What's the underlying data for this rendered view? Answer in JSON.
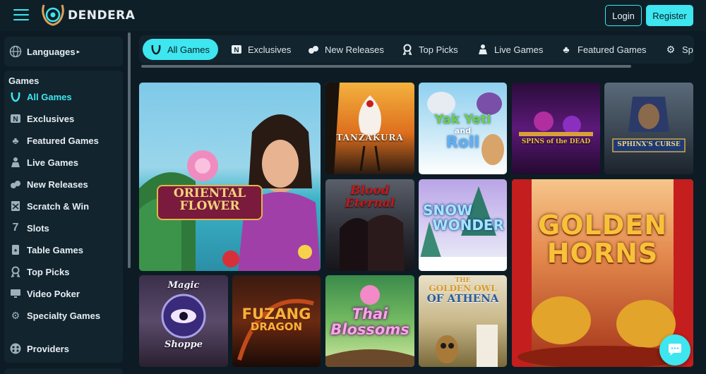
{
  "brand": {
    "name": "DENDERA"
  },
  "header": {
    "login_label": "Login",
    "register_label": "Register"
  },
  "sidebar": {
    "languages_label": "Languages",
    "games_heading": "Games",
    "items": [
      {
        "label": "All Games",
        "icon": "horseshoe-icon",
        "active": true
      },
      {
        "label": "Exclusives",
        "icon": "exclusive-badge-icon"
      },
      {
        "label": "Featured Games",
        "icon": "clover-icon"
      },
      {
        "label": "Live Games",
        "icon": "live-dealer-icon"
      },
      {
        "label": "New Releases",
        "icon": "new-cards-icon"
      },
      {
        "label": "Scratch & Win",
        "icon": "scratch-card-icon"
      },
      {
        "label": "Slots",
        "icon": "seven-icon"
      },
      {
        "label": "Table Games",
        "icon": "playing-card-icon"
      },
      {
        "label": "Top Picks",
        "icon": "medal-icon"
      },
      {
        "label": "Video Poker",
        "icon": "monitor-icon"
      },
      {
        "label": "Specialty Games",
        "icon": "gear-icon"
      }
    ],
    "providers_label": "Providers"
  },
  "tabs": [
    {
      "label": "All Games",
      "icon": "horseshoe-icon",
      "active": true
    },
    {
      "label": "Exclusives",
      "icon": "exclusive-badge-icon"
    },
    {
      "label": "New Releases",
      "icon": "new-cards-icon"
    },
    {
      "label": "Top Picks",
      "icon": "medal-icon"
    },
    {
      "label": "Live Games",
      "icon": "live-dealer-icon"
    },
    {
      "label": "Featured Games",
      "icon": "clover-icon"
    },
    {
      "label": "Sp",
      "icon": "gear-icon"
    }
  ],
  "games": {
    "oriental_flower": {
      "title_line1": "ORIENTAL",
      "title_line2": "FLOWER"
    },
    "tanzakura": {
      "title": "TANZAKURA"
    },
    "yak_yeti": {
      "title_line1": "Yak Yeti",
      "title_line2": "and",
      "title_line3": "Roll"
    },
    "spins_of_the_dead": {
      "title": "SPINS of the DEAD"
    },
    "sphinxs_curse": {
      "title": "SPHINX'S CURSE"
    },
    "blood_eternal": {
      "title_line1": "Blood",
      "title_line2": "Eternal"
    },
    "snow_wonder": {
      "title_line1": "SNOW",
      "title_line2": "WONDER"
    },
    "golden_horns": {
      "title_line1": "GOLDEN",
      "title_line2": "HORNS"
    },
    "magic_shoppe": {
      "title_line1": "Magic",
      "title_line2": "Shoppe"
    },
    "fuzang_dragon": {
      "title_line1": "FUZANG",
      "title_line2": "DRAGON"
    },
    "thai_blossoms": {
      "title_line1": "Thai",
      "title_line2": "Blossoms"
    },
    "golden_owl": {
      "title_line1": "THE",
      "title_line2": "GOLDEN OWL",
      "title_line3": "OF ATHENA"
    }
  },
  "colors": {
    "accent": "#3ee6ef",
    "background": "#0d1c24",
    "panel": "#12242e"
  }
}
